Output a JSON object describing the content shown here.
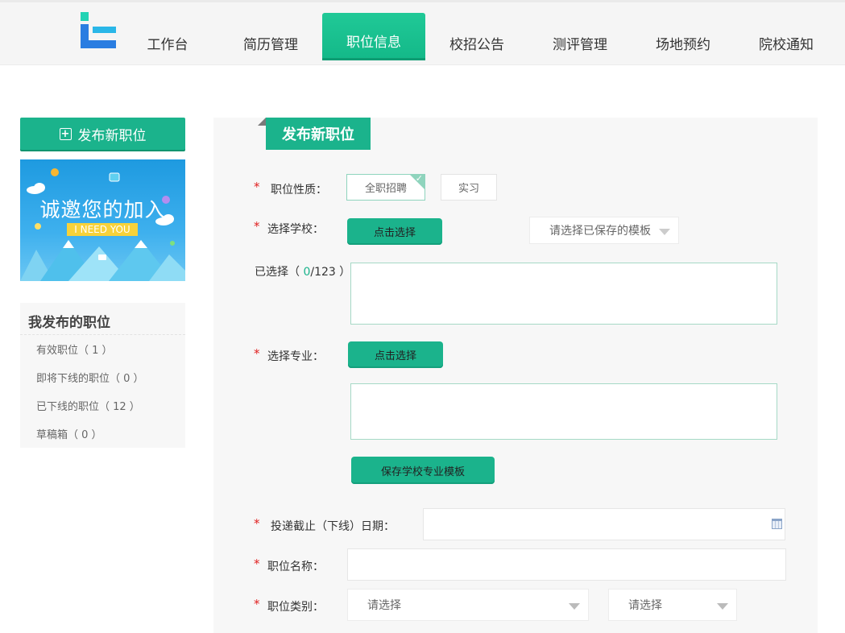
{
  "nav": {
    "items": [
      {
        "label": "工作台"
      },
      {
        "label": "简历管理"
      },
      {
        "label": "职位信息"
      },
      {
        "label": "校招公告"
      },
      {
        "label": "测评管理"
      },
      {
        "label": "场地预约"
      },
      {
        "label": "院校通知"
      }
    ],
    "active_index": 2
  },
  "sidebar": {
    "publish_button": "发布新职位",
    "banner": {
      "title": "诚邀您的加入",
      "subtitle": "I NEED YOU"
    },
    "my_posts": {
      "title": "我发布的职位",
      "items": [
        {
          "label": "有效职位（ 1 ）"
        },
        {
          "label": "即将下线的职位（ 0 ）"
        },
        {
          "label": "已下线的职位（ 12 ）"
        },
        {
          "label": "草稿箱（ 0 ）"
        }
      ]
    }
  },
  "form": {
    "tab_title": "发布新职位",
    "required_mark": "*",
    "job_nature": {
      "label": "职位性质：",
      "options": [
        "全职招聘",
        "实习"
      ],
      "selected": "全职招聘"
    },
    "select_school": {
      "label": "选择学校：",
      "button": "点击选择",
      "template_placeholder": "请选择已保存的模板"
    },
    "selected_schools": {
      "prefix": "已选择（ ",
      "count": "0",
      "total": "/123 ）:"
    },
    "select_major": {
      "label": "选择专业：",
      "button": "点击选择"
    },
    "save_template_button": "保存学校专业模板",
    "deadline": {
      "label": "投递截止（下线）日期："
    },
    "job_name": {
      "label": "职位名称："
    },
    "job_category": {
      "label": "职位类别：",
      "placeholder_1": "请选择",
      "placeholder_2": "请选择"
    }
  },
  "colors": {
    "accent": "#1bb38c",
    "required": "#e02020",
    "count": "#1bb38c"
  }
}
